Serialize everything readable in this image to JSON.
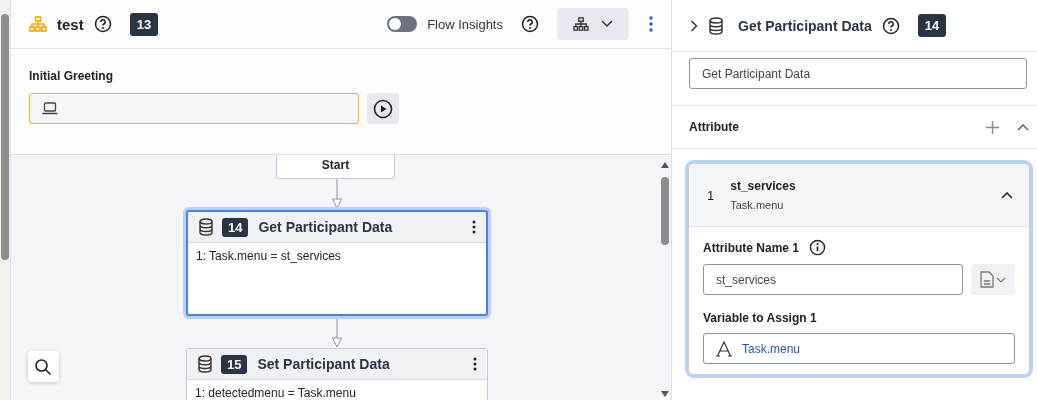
{
  "flow": {
    "title": "test",
    "id": "13",
    "insights": {
      "label": "Flow Insights",
      "on": false
    }
  },
  "greeting": {
    "label": "Initial Greeting"
  },
  "canvas": {
    "start": "Start",
    "nodes": [
      {
        "number": "14",
        "title": "Get Participant Data",
        "lines": [
          "1: Task.menu = st_services"
        ],
        "selected": true
      },
      {
        "number": "15",
        "title": "Set Participant Data",
        "lines": [
          "1: detectedmenu = Task.menu"
        ],
        "selected": false
      }
    ]
  },
  "panel": {
    "title": "Get Participant Data",
    "id": "14",
    "name_value": "Get Participant Data",
    "section": "Attribute",
    "attributes": [
      {
        "index": "1",
        "name": "st_services",
        "variable": "Task.menu",
        "expanded": true,
        "name_label": "Attribute Name 1",
        "name_value": "st_services",
        "variable_label": "Variable to Assign 1",
        "variable_value": "Task.menu"
      }
    ]
  }
}
